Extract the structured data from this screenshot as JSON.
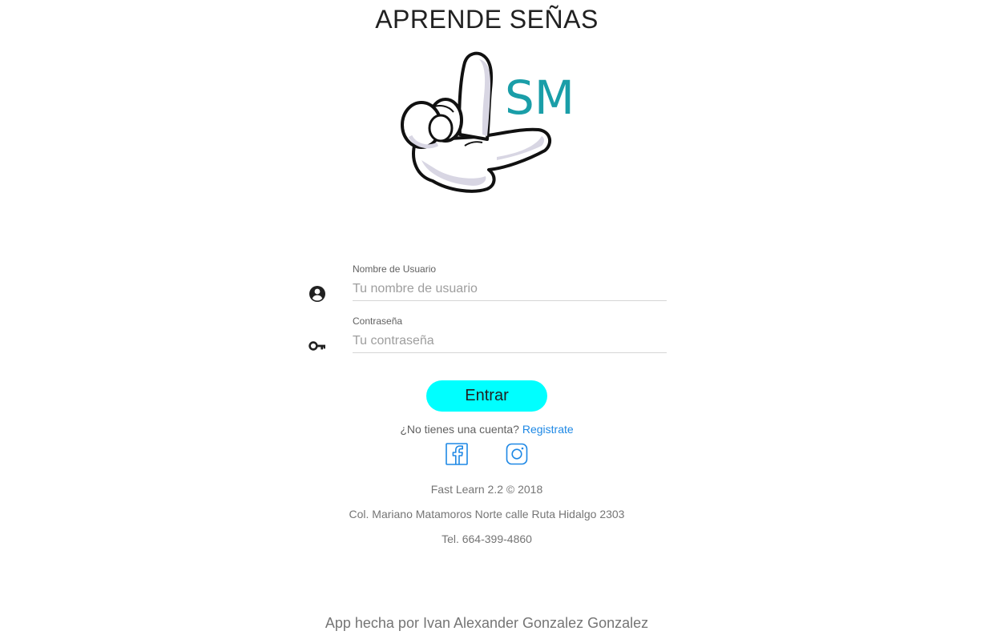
{
  "header": {
    "title": "APRENDE SEÑAS"
  },
  "logo": {
    "text": "SM",
    "color": "#1a9ea8",
    "icon": "pointing-hand-glove-icon"
  },
  "form": {
    "username": {
      "label": "Nombre de Usuario",
      "placeholder": "Tu nombre de usuario",
      "value": "",
      "icon": "account-circle-icon"
    },
    "password": {
      "label": "Contraseña",
      "placeholder": "Tu contraseña",
      "value": "",
      "icon": "key-icon"
    },
    "submit_label": "Entrar",
    "submit_color": "#00ffff"
  },
  "signup": {
    "prompt": "¿No tienes una cuenta?",
    "link_label": "Registrate",
    "link_color": "#1e88e5"
  },
  "social": {
    "icons": [
      "facebook-icon",
      "instagram-icon"
    ],
    "color": "#1e88e5"
  },
  "footer": {
    "version": "Fast Learn 2.2 © 2018",
    "address": "Col. Mariano Matamoros Norte calle Ruta Hidalgo 2303",
    "phone": "Tel. 664-399-4860"
  },
  "credit": {
    "text": "App hecha por Ivan Alexander Gonzalez Gonzalez"
  }
}
